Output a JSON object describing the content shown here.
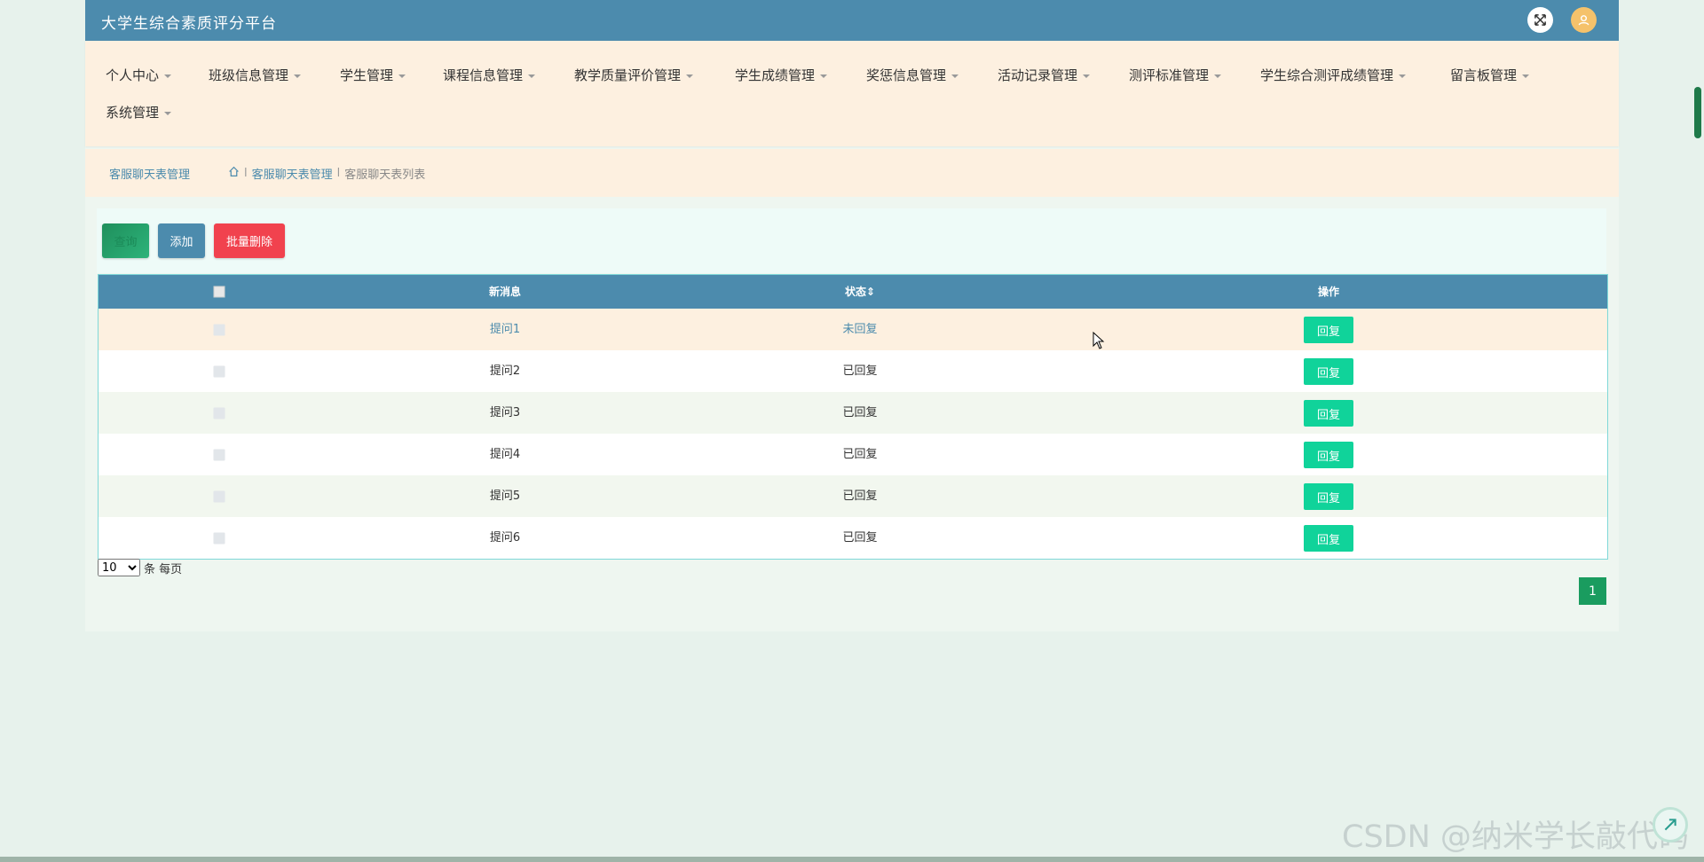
{
  "app": {
    "title": "大学生综合素质评分平台"
  },
  "nav": {
    "items": [
      {
        "label": "个人中心"
      },
      {
        "label": "班级信息管理"
      },
      {
        "label": "学生管理"
      },
      {
        "label": "课程信息管理"
      },
      {
        "label": "教学质量评价管理"
      },
      {
        "label": "学生成绩管理"
      },
      {
        "label": "奖惩信息管理"
      },
      {
        "label": "活动记录管理"
      },
      {
        "label": "测评标准管理"
      },
      {
        "label": "学生综合测评成绩管理"
      },
      {
        "label": "留言板管理"
      },
      {
        "label": "系统管理"
      }
    ]
  },
  "breadcrumb": {
    "title": "客服聊天表管理",
    "items": [
      "客服聊天表管理",
      "客服聊天表列表"
    ],
    "separator": "l"
  },
  "toolbar": {
    "search_label": "查询",
    "add_label": "添加",
    "batch_delete_label": "批量删除"
  },
  "table": {
    "headers": {
      "message": "新消息",
      "status": "状态",
      "sort_glyph": "⇕",
      "actions": "操作"
    },
    "rows": [
      {
        "message": "提问1",
        "status": "未回复",
        "action": "回复"
      },
      {
        "message": "提问2",
        "status": "已回复",
        "action": "回复"
      },
      {
        "message": "提问3",
        "status": "已回复",
        "action": "回复"
      },
      {
        "message": "提问4",
        "status": "已回复",
        "action": "回复"
      },
      {
        "message": "提问5",
        "status": "已回复",
        "action": "回复"
      },
      {
        "message": "提问6",
        "status": "已回复",
        "action": "回复"
      }
    ]
  },
  "pagination": {
    "page_size": "10",
    "page_size_options": [
      "10"
    ],
    "per_page_label": "条 每页",
    "current_page": "1"
  },
  "watermark": "CSDN @纳米学长敲代码",
  "colors": {
    "primary": "#4c8bad",
    "nav_bg": "#fdf0e0",
    "reply_button": "#10d39a",
    "delete_button": "#f1424e",
    "page_active": "#1a9c5f"
  }
}
